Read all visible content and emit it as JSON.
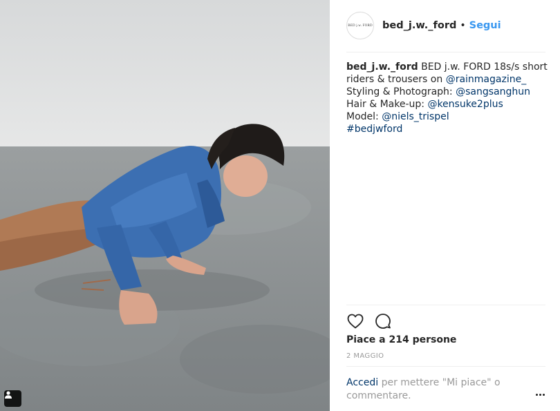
{
  "post": {
    "username": "bed_j.w._ford",
    "avatar_text": "BED j.w. FORD",
    "dot": "•",
    "follow_label": "Segui",
    "caption": {
      "username": "bed_j.w._ford",
      "text_1": " BED j.w. FORD 18s/s short",
      "text_2": "riders & trousers on ",
      "mention_rain": "@rainmagazine_",
      "text_3": "Styling & Photograph: ",
      "mention_sang": "@sangsanghun",
      "text_4": "Hair & Make-up: ",
      "mention_kensuke": "@kensuke2plus",
      "text_5": "Model: ",
      "mention_niels": "@niels_trispel",
      "hashtag": "#bedjwford"
    },
    "likes_text": "Piace a 214 persone",
    "date": "2 MAGGIO",
    "login_link": "Accedi",
    "login_rest": " per mettere \"Mi piace\" o commentare."
  },
  "icons": {
    "like": "heart-icon",
    "comment": "comment-bubble-icon",
    "more": "more-options-icon",
    "tag": "user-tag-icon"
  },
  "colors": {
    "link_blue": "#3897f0",
    "mention_blue": "#003569",
    "text": "#262626",
    "muted": "#999999",
    "divider": "#efefef"
  }
}
